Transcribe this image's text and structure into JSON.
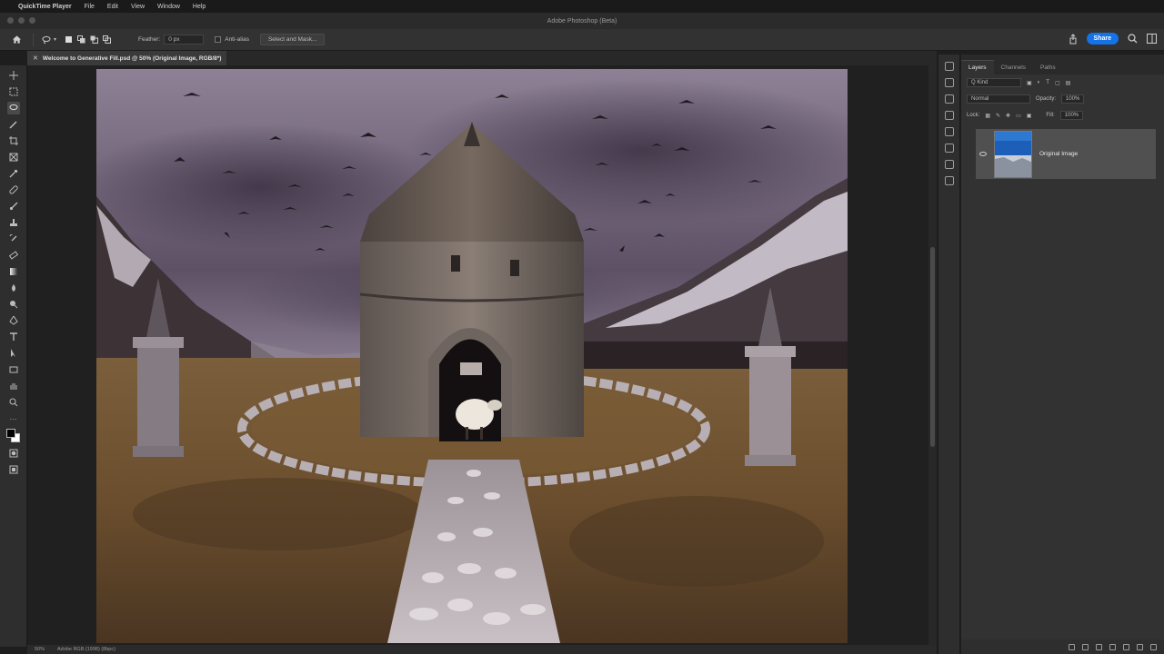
{
  "menubar": {
    "app_name": "QuickTime Player",
    "items": [
      "File",
      "Edit",
      "View",
      "Window",
      "Help"
    ]
  },
  "window": {
    "title": "Adobe Photoshop (Beta)"
  },
  "options": {
    "feather_label": "Feather:",
    "feather_value": "0 px",
    "antialias_label": "Anti-alias",
    "select_mask_label": "Select and Mask...",
    "share_label": "Share"
  },
  "document": {
    "tab_label": "Welcome to Generative Fill.psd @ 50% (Original Image, RGB/8*)"
  },
  "status": {
    "zoom": "50%",
    "profile": "Adobe RGB (1998) (8bpc)"
  },
  "layers_panel": {
    "tabs": [
      "Layers",
      "Channels",
      "Paths"
    ],
    "kind_filter": "Q Kind",
    "blend_mode": "Normal",
    "opacity_label": "Opacity:",
    "opacity_value": "100%",
    "lock_label": "Lock:",
    "fill_label": "Fill:",
    "fill_value": "100%",
    "layer_name": "Original Image"
  },
  "colors": {
    "accent": "#1473e6",
    "sky": "#6c5f74",
    "ground": "#6e5530"
  },
  "icons": [
    "home-icon",
    "lasso-icon",
    "search-icon",
    "share-icon",
    "panel-layout-icon"
  ]
}
